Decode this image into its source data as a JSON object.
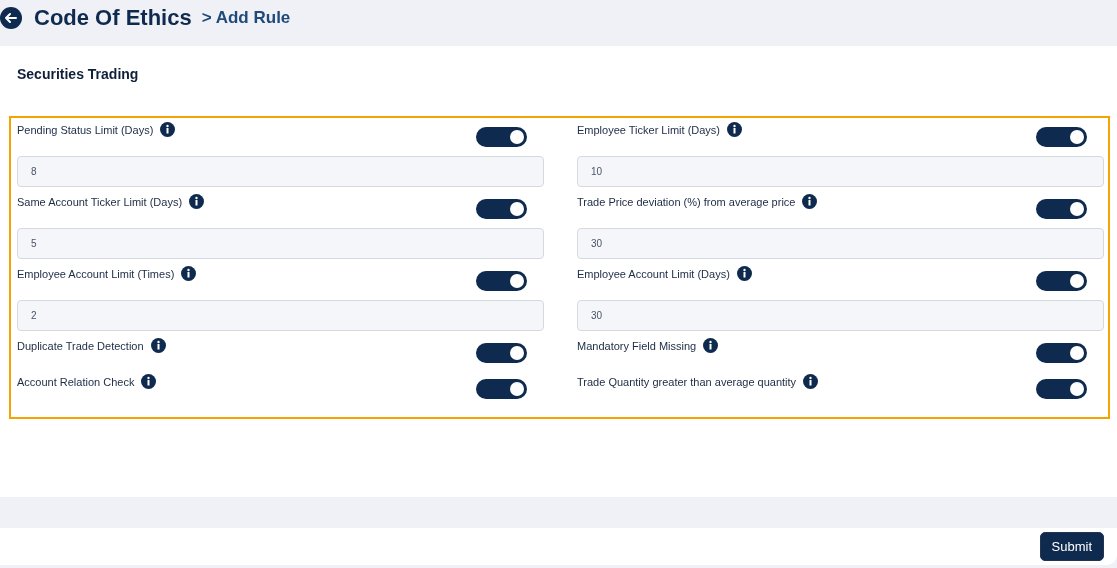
{
  "header": {
    "title": "Code Of Ethics",
    "breadcrumb": "> Add Rule"
  },
  "section": {
    "title": "Securities Trading"
  },
  "rules": [
    {
      "label": "Pending Status Limit (Days)",
      "on": true,
      "value": "8"
    },
    {
      "label": "Employee Ticker Limit (Days)",
      "on": true,
      "value": "10"
    },
    {
      "label": "Same Account Ticker Limit (Days)",
      "on": true,
      "value": "5"
    },
    {
      "label": "Trade Price deviation (%) from average price",
      "on": true,
      "value": "30"
    },
    {
      "label": "Employee Account Limit (Times)",
      "on": true,
      "value": "2"
    },
    {
      "label": "Employee Account Limit (Days)",
      "on": true,
      "value": "30"
    },
    {
      "label": "Duplicate Trade Detection",
      "on": true
    },
    {
      "label": "Mandatory Field Missing",
      "on": true
    },
    {
      "label": "Account Relation Check",
      "on": true
    },
    {
      "label": "Trade Quantity greater than average quantity",
      "on": true
    }
  ],
  "submit": "Submit"
}
